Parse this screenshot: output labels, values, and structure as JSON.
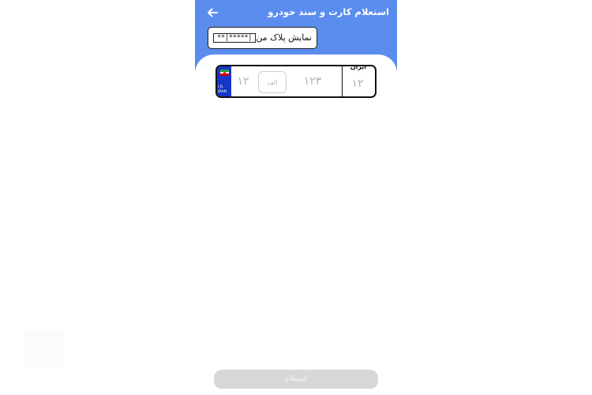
{
  "header": {
    "title": "استعلام کارت و سند خودرو",
    "back_icon": "arrow-left-icon"
  },
  "mask_toggle": {
    "label": "نمایش پلاک من",
    "value": "**|*****|"
  },
  "plate": {
    "country_name": "ایران",
    "country_code": "I.R.\nIRAN",
    "two_digit": "۱۲",
    "letter": "الف",
    "three_digit": "۱۲۳",
    "region_code": "۱۲"
  },
  "submit": {
    "label": "استعلام"
  },
  "colors": {
    "header": "#5b8def",
    "plate_blue": "#1636c9",
    "button_disabled": "#d7d7d7"
  }
}
